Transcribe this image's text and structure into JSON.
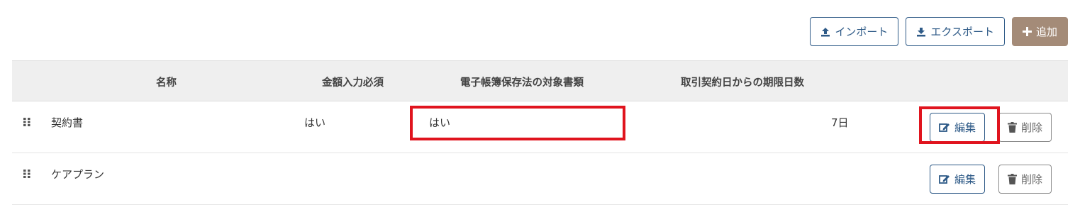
{
  "toolbar": {
    "import_label": "インポート",
    "export_label": "エクスポート",
    "add_label": "追加"
  },
  "table": {
    "headers": {
      "name": "名称",
      "amount_required": "金額入力必須",
      "ebook_target": "電子帳簿保存法の対象書類",
      "deadline_days": "取引契約日からの期限日数"
    },
    "rows": [
      {
        "name": "契約書",
        "amount_required": "はい",
        "ebook_target": "はい",
        "deadline_days": "7日",
        "edit_label": "編集",
        "delete_label": "削除"
      },
      {
        "name": "ケアプラン",
        "amount_required": "",
        "ebook_target": "",
        "deadline_days": "",
        "edit_label": "編集",
        "delete_label": "削除"
      }
    ]
  },
  "colors": {
    "primary": "#2e5a87",
    "add_button": "#a48b78",
    "highlight": "#e0141e"
  }
}
